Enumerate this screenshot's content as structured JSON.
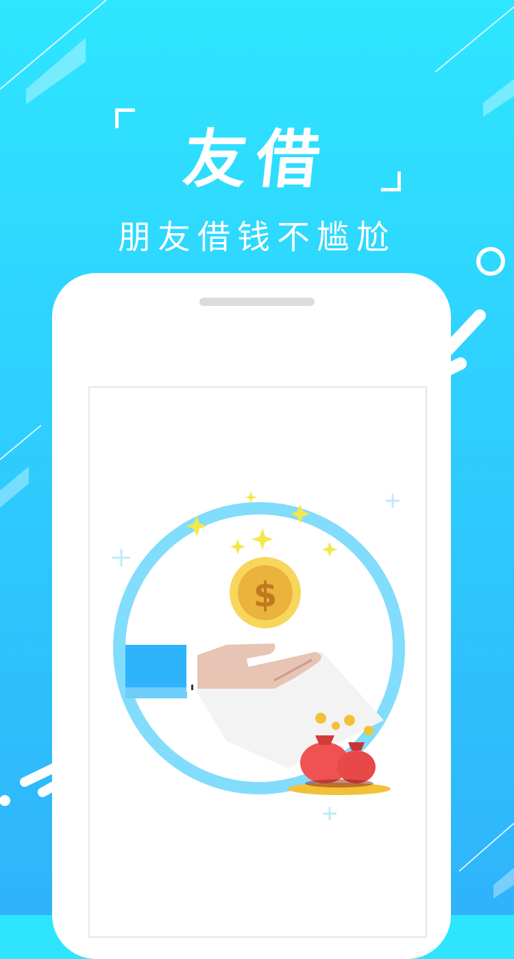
{
  "hero": {
    "app_name": "友借",
    "slogan": "朋友借钱不尴尬"
  },
  "colors": {
    "bg_top": "#2ee6ff",
    "bg_bottom": "#2fb3fb",
    "ring": "#7fdcff",
    "coin": "#f1c04a",
    "bag": "#f05252",
    "sleeve": "#2db4fb",
    "hand": "#e7c4b3"
  },
  "illustration": {
    "coin_symbol": "$",
    "icons": [
      "dollar-coin-icon",
      "hand-icon",
      "money-bag-icon",
      "sparkle-icon"
    ]
  }
}
